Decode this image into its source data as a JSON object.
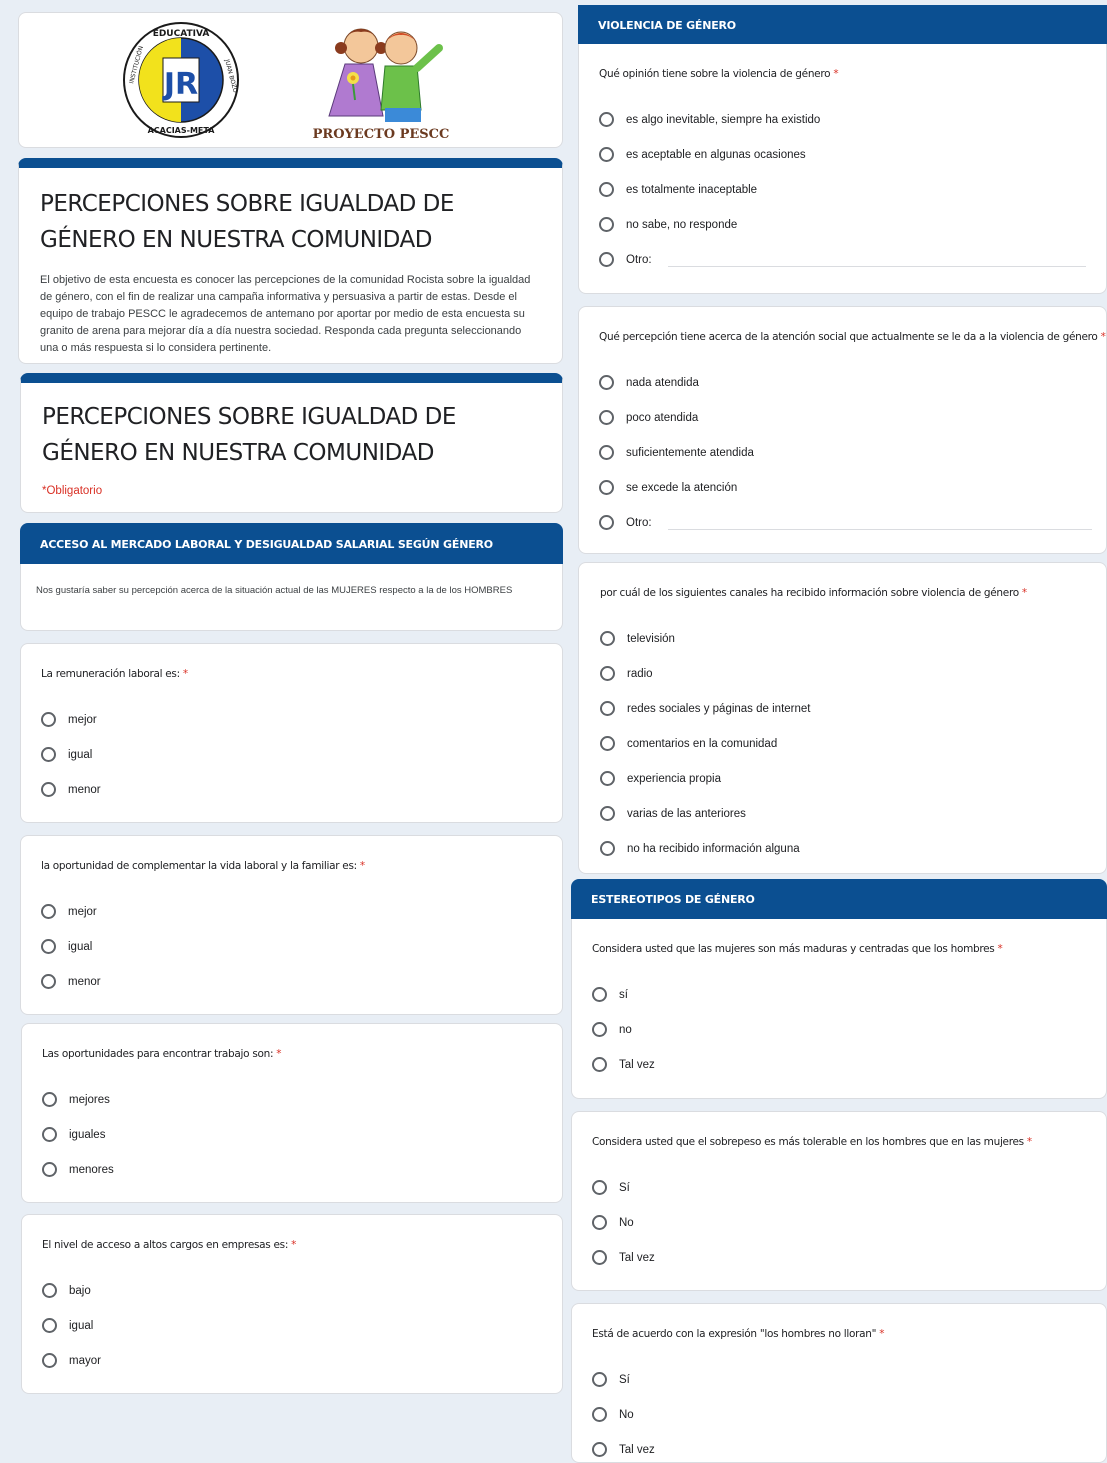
{
  "logos": {
    "school_top": "EDUCATIVA",
    "school_left": "INSTITUCIÓN",
    "school_right": "JUAN BOZO",
    "school_bottom": "ACACIAS-META",
    "school_initials": "JR",
    "project": "PROYECTO PESCC"
  },
  "form": {
    "title": "PERCEPCIONES SOBRE IGUALDAD DE GÉNERO EN NUESTRA COMUNIDAD",
    "description": "El objetivo de esta encuesta es conocer las percepciones de la comunidad Rocista sobre la igualdad de género, con el fin de realizar una campaña informativa y persuasiva a partir de estas. Desde el equipo de trabajo PESCC le agradecemos de antemano  por aportar por medio de esta encuesta su granito de arena para mejorar día a día  nuestra sociedad. Responda cada pregunta seleccionando una o más respuesta si lo considera pertinente.",
    "title2": "PERCEPCIONES SOBRE IGUALDAD DE GÉNERO EN NUESTRA COMUNIDAD",
    "required_note": "*Obligatorio"
  },
  "section1": {
    "header": "ACCESO AL MERCADO LABORAL Y DESIGUALDAD SALARIAL SEGÚN GÉNERO",
    "description": "Nos gustaría saber su percepción acerca de la situación actual  de las MUJERES respecto a la de los HOMBRES"
  },
  "questions_left": [
    {
      "title": "La remuneración laboral es:",
      "options": [
        "mejor",
        "igual",
        "menor"
      ]
    },
    {
      "title": "la oportunidad de complementar la vida laboral y la familiar es:",
      "options": [
        "mejor",
        "igual",
        "menor"
      ]
    },
    {
      "title": "Las oportunidades para encontrar trabajo son:",
      "options": [
        "mejores",
        "iguales",
        "menores"
      ]
    },
    {
      "title": "El nivel de acceso a altos cargos en empresas es:",
      "options": [
        "bajo",
        "igual",
        "mayor"
      ]
    }
  ],
  "section2": {
    "header": "VIOLENCIA DE GÉNERO"
  },
  "questions_violence": [
    {
      "title": "Qué opinión tiene sobre la violencia de género",
      "options": [
        "es algo inevitable, siempre ha existido",
        "es aceptable en algunas ocasiones",
        "es totalmente inaceptable",
        "no sabe, no responde"
      ],
      "other": "Otro:"
    },
    {
      "title": "Qué percepción tiene acerca de la atención social que actualmente se le da a la violencia de género",
      "options": [
        "nada atendida",
        "poco atendida",
        "suficientemente atendida",
        "se excede la atención"
      ],
      "other": "Otro:"
    },
    {
      "title": "por cuál de los siguientes canales ha recibido información sobre violencia de género",
      "options": [
        "televisión",
        "radio",
        "redes sociales y páginas de internet",
        "comentarios en la comunidad",
        "experiencia propia",
        "varias de las anteriores",
        "no ha recibido información alguna"
      ]
    }
  ],
  "section3": {
    "header": "ESTEREOTIPOS DE GÉNERO"
  },
  "questions_stereo": [
    {
      "title": "Considera usted que las mujeres son más maduras y centradas que los hombres",
      "options": [
        "sí",
        "no",
        "Tal vez"
      ]
    },
    {
      "title": "Considera usted que el sobrepeso es más tolerable en los hombres que en las mujeres",
      "options": [
        "Sí",
        "No",
        "Tal vez"
      ]
    },
    {
      "title": "Está de acuerdo con la expresión \"los hombres no lloran\"",
      "options": [
        "Sí",
        "No",
        "Tal vez"
      ]
    }
  ],
  "required_mark": "*",
  "colors": {
    "accent": "#0b4f91",
    "required": "#d93025"
  }
}
